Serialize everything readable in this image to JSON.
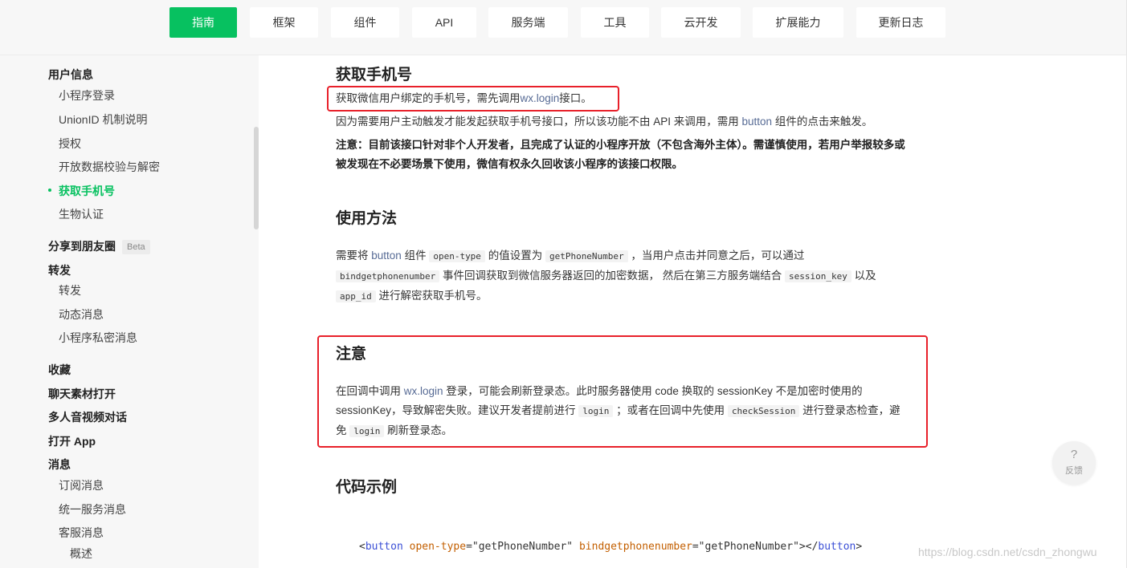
{
  "nav": {
    "tabs": [
      {
        "label": "指南",
        "active": true
      },
      {
        "label": "框架"
      },
      {
        "label": "组件"
      },
      {
        "label": "API"
      },
      {
        "label": "服务端"
      },
      {
        "label": "工具"
      },
      {
        "label": "云开发"
      },
      {
        "label": "扩展能力"
      },
      {
        "label": "更新日志"
      }
    ]
  },
  "sidebar": {
    "items": [
      {
        "label": "用户信息",
        "type": "group"
      },
      {
        "label": "小程序登录",
        "type": "sub"
      },
      {
        "label": "UnionID 机制说明",
        "type": "sub"
      },
      {
        "label": "授权",
        "type": "sub"
      },
      {
        "label": "开放数据校验与解密",
        "type": "sub"
      },
      {
        "label": "获取手机号",
        "type": "sub",
        "active": true
      },
      {
        "label": "生物认证",
        "type": "sub"
      },
      {
        "label": "分享到朋友圈",
        "type": "group",
        "badge": "Beta"
      },
      {
        "label": "转发",
        "type": "group"
      },
      {
        "label": "转发",
        "type": "sub"
      },
      {
        "label": "动态消息",
        "type": "sub"
      },
      {
        "label": "小程序私密消息",
        "type": "sub"
      },
      {
        "label": "收藏",
        "type": "group"
      },
      {
        "label": "聊天素材打开",
        "type": "group"
      },
      {
        "label": "多人音视频对话",
        "type": "group"
      },
      {
        "label": "打开 App",
        "type": "group"
      },
      {
        "label": "消息",
        "type": "group"
      },
      {
        "label": "订阅消息",
        "type": "sub"
      },
      {
        "label": "统一服务消息",
        "type": "sub"
      },
      {
        "label": "客服消息",
        "type": "sub"
      },
      {
        "label": "概述",
        "type": "subsub"
      }
    ]
  },
  "content": {
    "section1": {
      "title": "获取手机号",
      "line1_pre": "获取微信用户绑定的手机号，需先调用",
      "line1_link": "wx.login",
      "line1_post": "接口。",
      "line2_pre": "因为需要用户主动触发才能发起获取手机号接口，所以该功能不由 API 来调用，需用 ",
      "line2_link": "button",
      "line2_post": " 组件的点击来触发。",
      "note": "注意：目前该接口针对非个人开发者，且完成了认证的小程序开放（不包含海外主体）。需谨慎使用，若用户举报较多或被发现在不必要场景下使用，微信有权永久回收该小程序的该接口权限。"
    },
    "section2": {
      "title": "使用方法",
      "t1": "需要将 ",
      "link1": "button",
      "t2": " 组件 ",
      "code1": "open-type",
      "t3": " 的值设置为 ",
      "code2": "getPhoneNumber",
      "t4": " ，当用户点击并同意之后，可以通过",
      "code3": "bindgetphonenumber",
      "t5": " 事件回调获取到微信服务器返回的加密数据， 然后在第三方服务端结合 ",
      "code4": "session_key",
      "t6": " 以及",
      "code5": "app_id",
      "t7": " 进行解密获取手机号。"
    },
    "section3": {
      "title": "注意",
      "t1": "在回调中调用 ",
      "link1": "wx.login",
      "t2": " 登录，可能会刷新登录态。此时服务器使用 code 换取的 sessionKey 不是加密时使用的 sessionKey，导致解密失败。建议开发者提前进行 ",
      "code1": "login",
      "t3": " ；或者在回调中先使用 ",
      "code2": "checkSession",
      "t4": " 进行登录态检查，避免 ",
      "code3": "login",
      "t5": " 刷新登录态。"
    },
    "section4": {
      "title": "代码示例",
      "code": {
        "open": "<",
        "tag": "button",
        "attr1": "open-type",
        "val1": "=\"getPhoneNumber\"",
        "attr2": "bindgetphonenumber",
        "val2": "=\"getPhoneNumber\"",
        "mid": "></",
        "tag2": "button",
        "close": ">"
      }
    }
  },
  "feedback": {
    "symbol": "?",
    "label": "反馈"
  },
  "watermark": "https://blog.csdn.net/csdn_zhongwu",
  "colors": {
    "accent": "#07c160",
    "link": "#576b95",
    "highlight": "#e8202a"
  }
}
